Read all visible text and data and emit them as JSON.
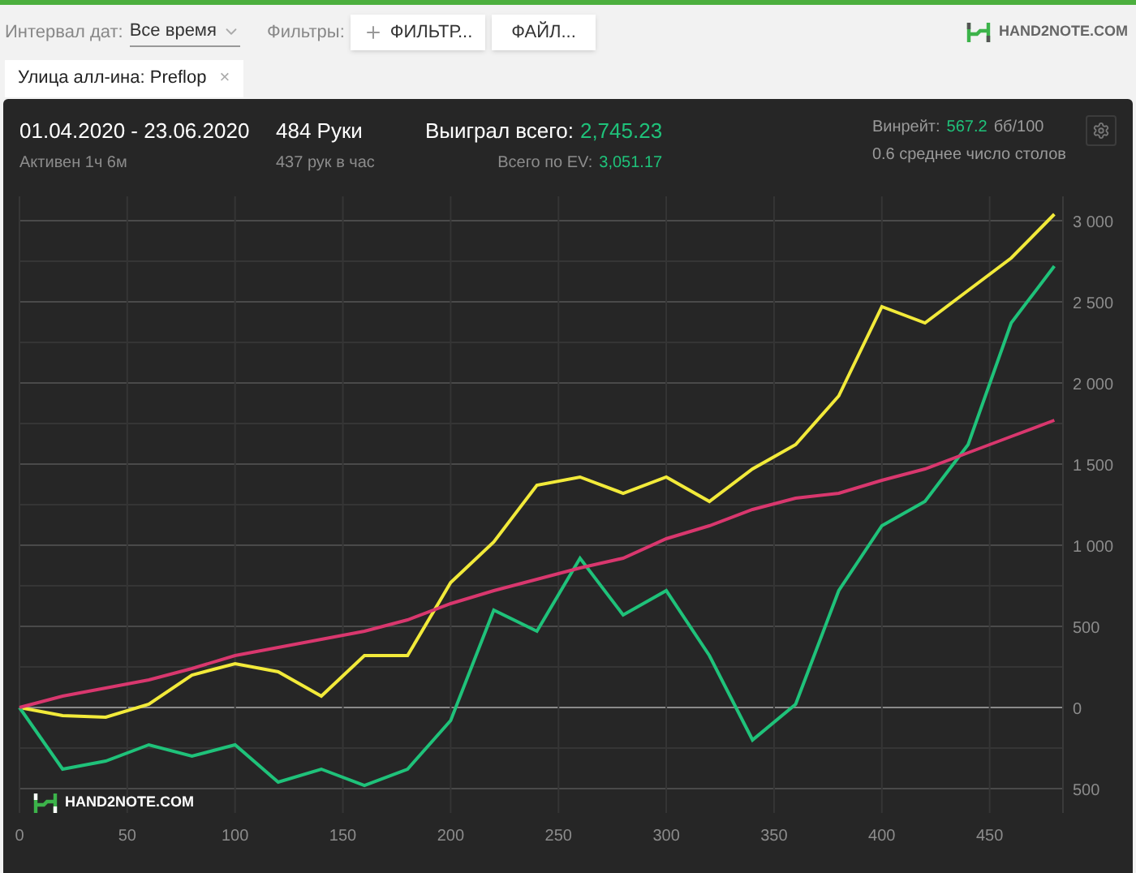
{
  "toolbar": {
    "date_label": "Интервал дат:",
    "date_value": "Все время",
    "filters_label": "Фильтры:",
    "filter_button": "ФИЛЬТР...",
    "file_button": "ФАЙЛ...",
    "logo": "HAND2NOTE.COM"
  },
  "tags": [
    {
      "label": "Улица алл-ина: Preflop",
      "close": "×"
    }
  ],
  "summary": {
    "period": "01.04.2020 - 23.06.2020",
    "active": "Активен 1ч 6м",
    "hands": "484 Руки",
    "hands_rate": "437 рук в час",
    "won_label": "Выиграл всего:",
    "won_value": "2,745.23",
    "ev_label": "Всего по EV:",
    "ev_value": "3,051.17",
    "winrate_label": "Винрейт:",
    "winrate_value": "567.2",
    "winrate_unit": "бб/100",
    "tables": "0.6 среднее число столов"
  },
  "chart": {
    "watermark": "HAND2NOTE.COM",
    "chart_data": {
      "type": "line",
      "grid": true,
      "xlim": [
        0,
        484
      ],
      "ylim": [
        -650,
        3150
      ],
      "xticks": [
        0,
        50,
        100,
        150,
        200,
        250,
        300,
        350,
        400,
        450
      ],
      "yticks": [
        {
          "value": -500,
          "label": "500"
        },
        {
          "value": 0,
          "label": "0"
        },
        {
          "value": 500,
          "label": "500"
        },
        {
          "value": 1000,
          "label": "1 000"
        },
        {
          "value": 1500,
          "label": "1 500"
        },
        {
          "value": 2000,
          "label": "2 000"
        },
        {
          "value": 2500,
          "label": "2 500"
        },
        {
          "value": 3000,
          "label": "3 000"
        }
      ],
      "x": [
        0,
        20,
        40,
        60,
        80,
        100,
        120,
        140,
        160,
        180,
        200,
        220,
        240,
        260,
        280,
        300,
        320,
        340,
        360,
        380,
        400,
        420,
        440,
        460,
        480
      ],
      "series": [
        {
          "color": "#f2ea3a",
          "values": [
            0,
            -50,
            -60,
            20,
            200,
            270,
            220,
            70,
            320,
            320,
            770,
            1020,
            1370,
            1420,
            1320,
            1420,
            1270,
            1470,
            1620,
            1920,
            2470,
            2370,
            2570,
            2770,
            3040
          ]
        },
        {
          "color": "#1fc27a",
          "values": [
            0,
            -380,
            -330,
            -230,
            -300,
            -230,
            -460,
            -380,
            -480,
            -380,
            -80,
            600,
            470,
            920,
            570,
            720,
            320,
            -200,
            20,
            720,
            1120,
            1270,
            1620,
            2370,
            2720
          ]
        },
        {
          "color": "#d9376e",
          "values": [
            0,
            70,
            120,
            170,
            240,
            320,
            370,
            420,
            470,
            540,
            640,
            720,
            790,
            860,
            920,
            1040,
            1120,
            1220,
            1290,
            1320,
            1400,
            1470,
            1570,
            1670,
            1770
          ]
        }
      ]
    }
  }
}
